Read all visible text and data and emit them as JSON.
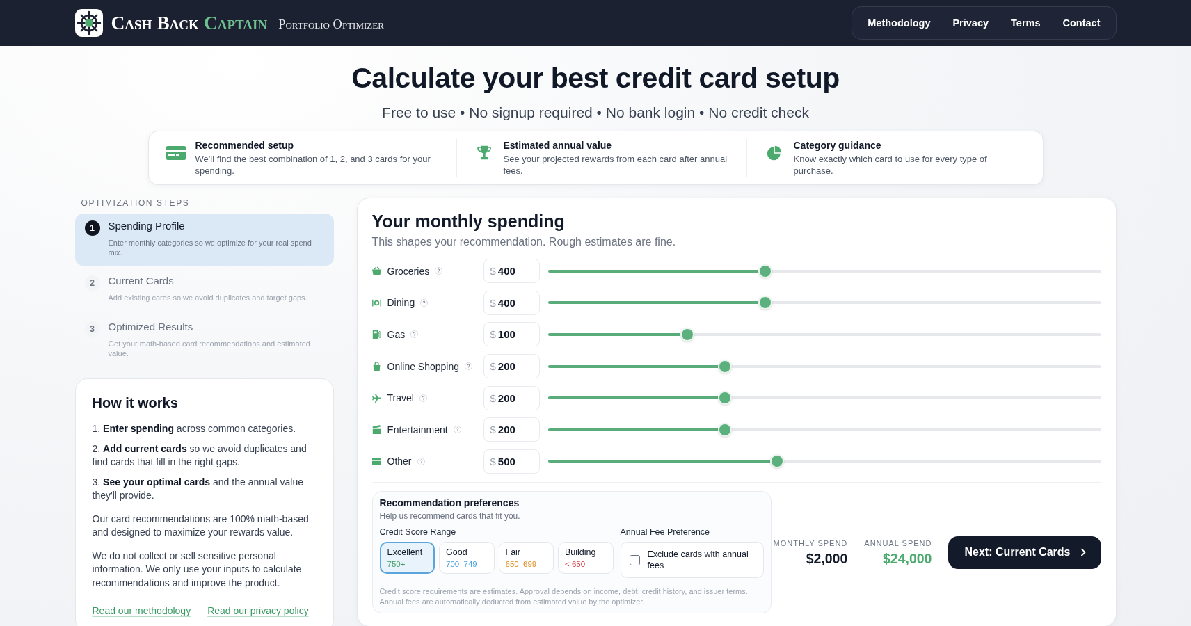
{
  "header": {
    "brand": {
      "name": "Cash Back",
      "accent": "Captain",
      "tagline": "Portfolio Optimizer"
    },
    "nav": [
      {
        "label": "Methodology"
      },
      {
        "label": "Privacy"
      },
      {
        "label": "Terms"
      },
      {
        "label": "Contact"
      }
    ]
  },
  "hero": {
    "title": "Calculate your best credit card setup",
    "subtitle": "Free to use • No signup required • No bank login • No credit check"
  },
  "features": [
    {
      "title": "Recommended setup",
      "description": "We'll find the best combination of 1, 2, and 3 cards for your spending."
    },
    {
      "title": "Estimated annual value",
      "description": "See your projected rewards from each card after annual fees."
    },
    {
      "title": "Category guidance",
      "description": "Know exactly which card to use for every type of purchase."
    }
  ],
  "steps": {
    "heading": "OPTIMIZATION STEPS",
    "items": [
      {
        "number": "1",
        "title": "Spending Profile",
        "description": "Enter monthly categories so we optimize for your real spend mix.",
        "selected": true
      },
      {
        "number": "2",
        "title": "Current Cards",
        "description": "Add existing cards so we avoid duplicates and target gaps.",
        "selected": false
      },
      {
        "number": "3",
        "title": "Optimized Results",
        "description": "Get your math-based card recommendations and estimated value.",
        "selected": false
      }
    ]
  },
  "how_it_works": {
    "title": "How it works",
    "steps": [
      "1. **Enter spending** across common categories.",
      "2. **Add current cards** so we avoid duplicates and find cards that fill in the right gaps.",
      "3. **See your optimal cards** and the annual value they'll provide."
    ],
    "paragraphs": [
      "Our card recommendations are 100% math-based and designed to maximize your rewards value.",
      "We do not collect or sell sensitive personal information. We only use your inputs to calculate recommendations and improve the product."
    ],
    "links": [
      {
        "label": "Read our methodology"
      },
      {
        "label": "Read our privacy policy"
      }
    ]
  },
  "spending": {
    "title": "Your monthly spending",
    "subtitle": "This shapes your recommendation. Rough estimates are fine.",
    "categories": [
      {
        "label": "Groceries",
        "prefix": "$",
        "amount": "400",
        "level": 0.393
      },
      {
        "label": "Dining",
        "prefix": "$",
        "amount": "400",
        "level": 0.393
      },
      {
        "label": "Gas",
        "prefix": "$",
        "amount": "100",
        "level": 0.252
      },
      {
        "label": "Online Shopping",
        "prefix": "$",
        "amount": "200",
        "level": 0.32
      },
      {
        "label": "Travel",
        "prefix": "$",
        "amount": "200",
        "level": 0.32
      },
      {
        "label": "Entertainment",
        "prefix": "$",
        "amount": "200",
        "level": 0.32
      },
      {
        "label": "Other",
        "prefix": "$",
        "amount": "500",
        "level": 0.415
      }
    ],
    "preferences": {
      "title": "Recommendation preferences",
      "subtitle": "Help us recommend cards that fit you.",
      "credit_label": "Credit Score Range",
      "credit_options": [
        {
          "label": "Excellent",
          "range": "750+",
          "color": "#3f9e63",
          "selected": true
        },
        {
          "label": "Good",
          "range": "700–749",
          "color": "#4aa3df",
          "selected": false
        },
        {
          "label": "Fair",
          "range": "650–699",
          "color": "#e0891b",
          "selected": false
        },
        {
          "label": "Building",
          "range": "< 650",
          "color": "#d6343a",
          "selected": false
        }
      ],
      "fee_label": "Annual Fee Preference",
      "fee_option": {
        "label": "Exclude cards with annual fees",
        "checked": false
      },
      "notes": [
        "Credit score requirements are estimates. Approval depends on income, debt, credit history, and issuer terms.",
        "Annual fees are automatically deducted from estimated value by the optimizer."
      ]
    },
    "totals": [
      {
        "label": "MONTHLY SPEND",
        "value": "$2,000",
        "color": "#111827"
      },
      {
        "label": "ANNUAL SPEND",
        "value": "$24,000",
        "color": "#4caa6f"
      }
    ],
    "next_button": {
      "label": "Next: Current Cards"
    }
  }
}
